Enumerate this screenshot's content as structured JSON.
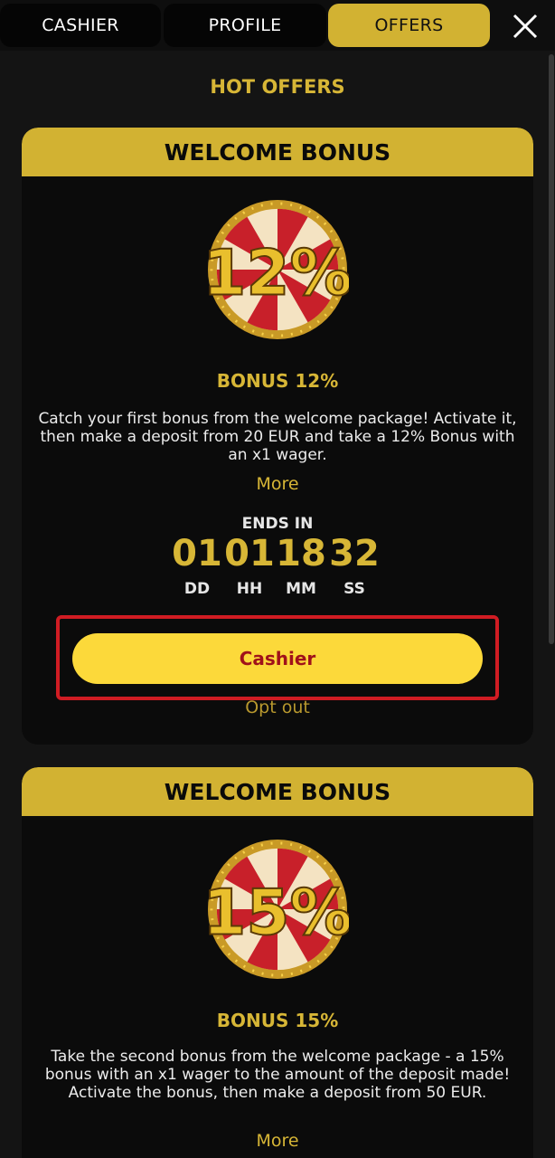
{
  "tabs": [
    {
      "label": "CASHIER",
      "active": false
    },
    {
      "label": "PROFILE",
      "active": false
    },
    {
      "label": "OFFERS",
      "active": true
    }
  ],
  "close_icon": "close-x-icon",
  "section_title": "HOT OFFERS",
  "offers": [
    {
      "header": "WELCOME BONUS",
      "badge_percent": "12%",
      "bonus_title": "BONUS 12%",
      "description": "Catch your first bonus from the welcome package! Activate it, then make a deposit from 20 EUR and take a 12% Bonus with an x1 wager.",
      "more_label": "More",
      "ends_in_label": "ENDS IN",
      "timer": [
        {
          "value": "01",
          "unit": "DD"
        },
        {
          "value": "01",
          "unit": "HH"
        },
        {
          "value": "18",
          "unit": "MM"
        },
        {
          "value": "32",
          "unit": "SS"
        }
      ],
      "cta_label": "Cashier",
      "optout_label": "Opt out"
    },
    {
      "header": "WELCOME BONUS",
      "badge_percent": "15%",
      "bonus_title": "BONUS 15%",
      "description": "Take the second bonus from the welcome package - a 15% bonus with an x1 wager to the amount of the deposit made! Activate the bonus, then make a deposit from 50 EUR.",
      "more_label": "More"
    }
  ],
  "colors": {
    "accent_gold": "#d2b232",
    "cta_yellow": "#fcd93a",
    "cta_text": "#a0121a",
    "highlight_red": "#d01c23",
    "background": "#141414"
  }
}
